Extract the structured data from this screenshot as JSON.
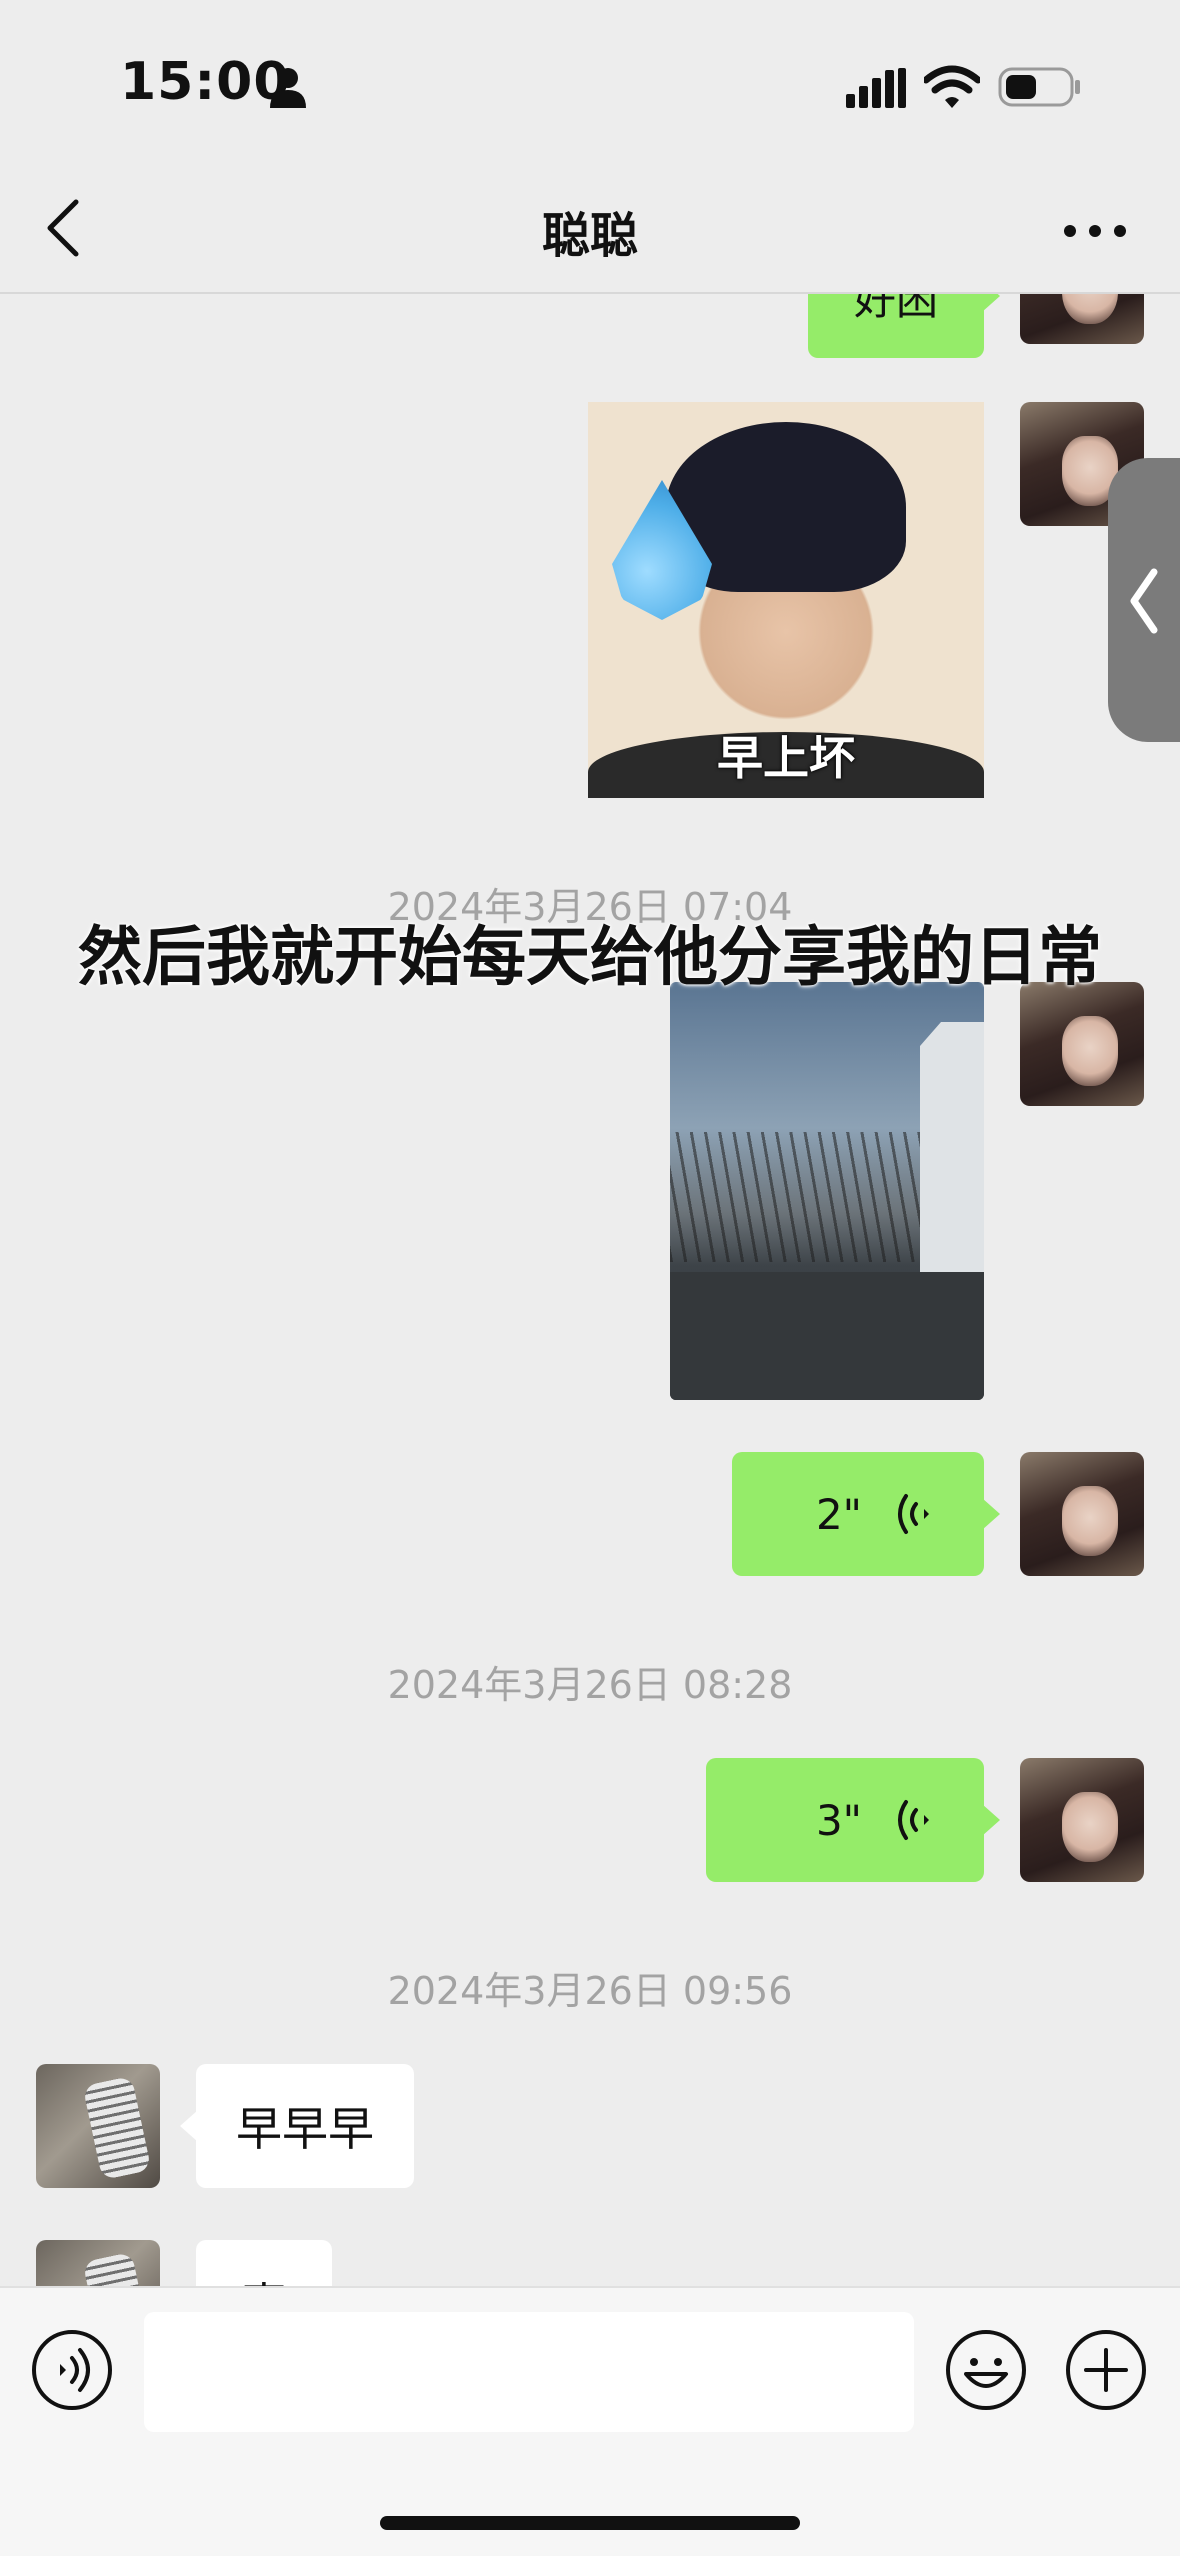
{
  "status_bar": {
    "time": "15:00",
    "icons": [
      "person-icon",
      "signal-icon",
      "wifi-icon",
      "battery-icon"
    ]
  },
  "nav": {
    "title": "聪聪",
    "back_icon": "chevron-left-icon",
    "more_icon": "more-dots-icon"
  },
  "messages": [
    {
      "type": "text",
      "from": "me",
      "text": "好困",
      "partially_visible": true
    },
    {
      "type": "sticker",
      "from": "me",
      "caption": "早上坏"
    },
    {
      "type": "timestamp",
      "text": "2024年3月26日 07:04"
    },
    {
      "type": "image",
      "from": "me"
    },
    {
      "type": "voice",
      "from": "me",
      "duration": "2\""
    },
    {
      "type": "timestamp",
      "text": "2024年3月26日 08:28"
    },
    {
      "type": "voice",
      "from": "me",
      "duration": "3\""
    },
    {
      "type": "timestamp",
      "text": "2024年3月26日 09:56"
    },
    {
      "type": "text",
      "from": "friend",
      "text": "早早早"
    },
    {
      "type": "text",
      "from": "friend",
      "text": "喜",
      "partially_visible": true
    }
  ],
  "overlay_caption": "然后我就开始每天给他分享我的日常",
  "input_bar": {
    "value": "",
    "icons": [
      "voice-input-icon",
      "emoji-icon",
      "plus-icon"
    ]
  },
  "colors": {
    "background": "#ededed",
    "my_bubble": "#95ec69",
    "friend_bubble": "#ffffff",
    "timestamp": "#a3a3a3"
  }
}
